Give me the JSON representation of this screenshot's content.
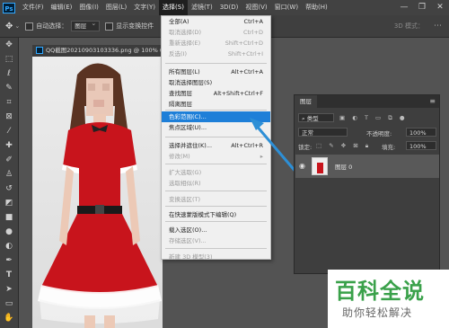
{
  "app": {
    "logo_text": "Ps"
  },
  "menubar": {
    "items": [
      "文件(F)",
      "编辑(E)",
      "图像(I)",
      "图层(L)",
      "文字(Y)",
      "选择(S)",
      "滤镜(T)",
      "3D(D)",
      "视图(V)",
      "窗口(W)",
      "帮助(H)"
    ],
    "active_index": 5
  },
  "window_controls": {
    "minimize": "—",
    "restore": "❐",
    "close": "✕"
  },
  "options_bar": {
    "auto_select_label": "自动选择：",
    "auto_select_value": "图层",
    "show_transform_label": "显示变换控件",
    "right_text": "3D 模式："
  },
  "document": {
    "tab_title": "QQ截图20210903103336.png @ 100% (图层 0, RGB/8#) *"
  },
  "select_menu": {
    "items": [
      {
        "label": "全部(A)",
        "shortcut": "Ctrl+A",
        "disabled": false
      },
      {
        "label": "取消选择(D)",
        "shortcut": "Ctrl+D",
        "disabled": true
      },
      {
        "label": "重新选择(E)",
        "shortcut": "Shift+Ctrl+D",
        "disabled": true
      },
      {
        "label": "反选(I)",
        "shortcut": "Shift+Ctrl+I",
        "disabled": true
      },
      {
        "label": "所有图层(L)",
        "shortcut": "Alt+Ctrl+A",
        "disabled": false
      },
      {
        "label": "取消选择图层(S)",
        "shortcut": "",
        "disabled": false
      },
      {
        "label": "查找图层",
        "shortcut": "Alt+Shift+Ctrl+F",
        "disabled": false
      },
      {
        "label": "隔离图层",
        "shortcut": "",
        "disabled": false
      },
      {
        "label": "色彩范围(C)...",
        "shortcut": "",
        "disabled": false,
        "highlighted": true
      },
      {
        "label": "焦点区域(U)...",
        "shortcut": "",
        "disabled": false
      },
      {
        "label": "选择并遮住(K)...",
        "shortcut": "Alt+Ctrl+R",
        "disabled": false
      },
      {
        "label": "修改(M)",
        "shortcut": "",
        "disabled": true,
        "submenu": true
      },
      {
        "label": "扩大选取(G)",
        "shortcut": "",
        "disabled": true
      },
      {
        "label": "选取相似(R)",
        "shortcut": "",
        "disabled": true
      },
      {
        "label": "变换选区(T)",
        "shortcut": "",
        "disabled": true
      },
      {
        "label": "在快速蒙版模式下编辑(Q)",
        "shortcut": "",
        "disabled": false
      },
      {
        "label": "载入选区(O)...",
        "shortcut": "",
        "disabled": false
      },
      {
        "label": "存储选区(V)...",
        "shortcut": "",
        "disabled": true
      },
      {
        "label": "新建 3D 模型(3)",
        "shortcut": "",
        "disabled": true
      }
    ]
  },
  "layers_panel": {
    "tab_label": "图层",
    "filter_label": "类型",
    "blend_mode": "正常",
    "opacity_label": "不透明度:",
    "opacity_value": "100%",
    "lock_label": "锁定:",
    "fill_label": "填充:",
    "fill_value": "100%",
    "layer_name": "图层 0"
  },
  "watermark": {
    "title": "百科全说",
    "subtitle": "助你轻松解决"
  },
  "colors": {
    "highlight": "#1e7fd8",
    "arrow": "#2d8fd6",
    "dress": "#c8141c"
  }
}
